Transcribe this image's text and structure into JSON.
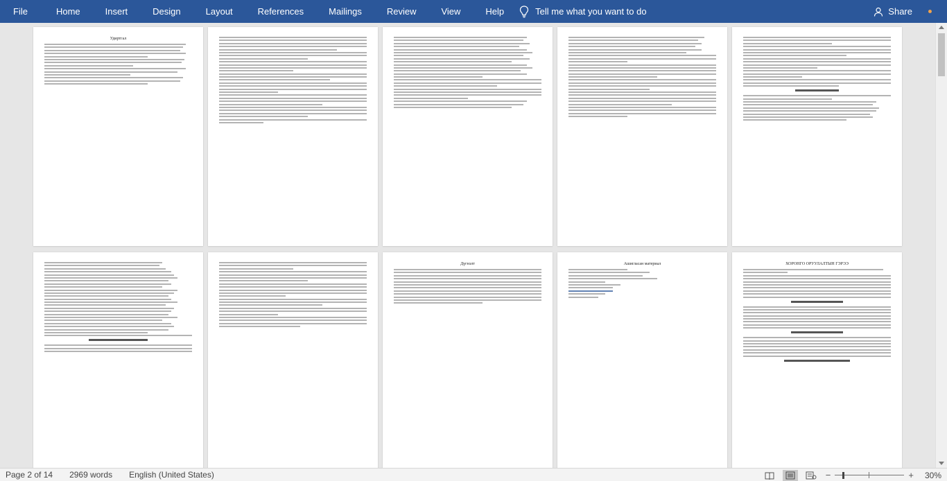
{
  "menu": {
    "file": "File",
    "tabs": [
      "Home",
      "Insert",
      "Design",
      "Layout",
      "References",
      "Mailings",
      "Review",
      "View",
      "Help"
    ],
    "tell_me": "Tell me what you want to do",
    "share": "Share"
  },
  "colors": {
    "ribbon": "#2b579a",
    "accent_dot": "#f0a24b"
  },
  "pages": [
    {
      "title": "Удиртгал",
      "number": ""
    },
    {
      "title": "",
      "number": ""
    },
    {
      "title": "",
      "number": ""
    },
    {
      "title": "",
      "number": ""
    },
    {
      "title": "",
      "number": ""
    },
    {
      "title": "",
      "number": ""
    },
    {
      "title": "",
      "number": ""
    },
    {
      "title": "Дүгнэлт",
      "number": ""
    },
    {
      "title": "Ашигласан материал",
      "number": ""
    },
    {
      "title": "ХОРОНГО ОРУУЛАЛТЫН ГЭРЭЭ",
      "number": ""
    }
  ],
  "status": {
    "page": "Page 2 of 14",
    "words": "2969 words",
    "language": "English (United States)",
    "zoom_minus": "−",
    "zoom_plus": "+",
    "zoom": "30%",
    "zoom_fraction": 0.3
  },
  "icons": {
    "tell": "lightbulb-icon",
    "share": "person-icon",
    "read_mode": "read-mode-icon",
    "print_layout": "print-layout-icon",
    "web_layout": "web-layout-icon"
  }
}
